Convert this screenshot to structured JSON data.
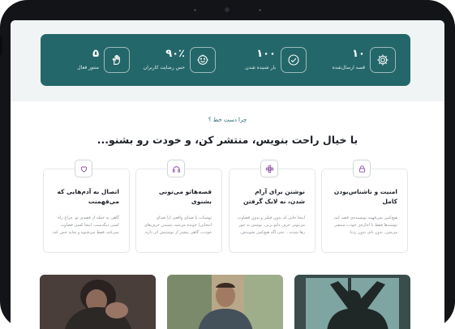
{
  "stats": [
    {
      "value": "۱۰",
      "label": "قصه ارسال‌شده",
      "icon": "gear-icon"
    },
    {
      "value": "۱۰۰",
      "label": "بار شنیده شدن",
      "icon": "check-icon"
    },
    {
      "value": "۹۰٪",
      "label": "حس رضایت کاربران",
      "icon": "smile-icon"
    },
    {
      "value": "۵",
      "label": "منتور فعال",
      "icon": "hand-icon"
    }
  ],
  "why": {
    "eyebrow": "چرا دست خط ؟",
    "headline": "با خیال راحت بنویس، منتشر کن، و خودت رو بشنو..."
  },
  "cards": [
    {
      "title": "امنیت و ناشناس‌بودن کامل",
      "text": "هیچ‌کس نمی‌فهمه نویسنده‌ی قصه کیه. نوشته‌ها فقط با اجازه‌ی خودت منتشر می‌شن. بدون نام، بدون ردپا.",
      "icon": "lock-icon"
    },
    {
      "title": "نوشتن برای آرام شدن، نه لایک گرفتن",
      "text": "اینجا جایی که بدون فیلتر و بدون قضاوت می‌تونی حرف دلتو بزنی. نوشتن یه جور رها شدنه... حتی اگه هیچ‌کس نخوندش.",
      "icon": "flower-icon"
    },
    {
      "title": "قصه‌هاتو می‌تونی بشنوی",
      "text": "نوشتات با صدای واقعی (یا صدای انتخابی) خونده می‌شه. شنیدن حرف‌های خودت، گاهی بیشتر از نوشتنش اثر داره.",
      "icon": "headphones-icon"
    },
    {
      "title": "اتصال به آدم‌هایی که می‌فهمنت",
      "text": "گاهی یه جمله از قصه‌ی تو، چراغ راه کسی دیگه‌ست. اینجا کسی قضاوت نمی‌کنه، فقط می‌شنوه و شاید حس کنه.",
      "icon": "heart-icon"
    }
  ],
  "colors": {
    "accent": "#24676a",
    "bezel": "#121417",
    "background": "#f1f4f5"
  }
}
